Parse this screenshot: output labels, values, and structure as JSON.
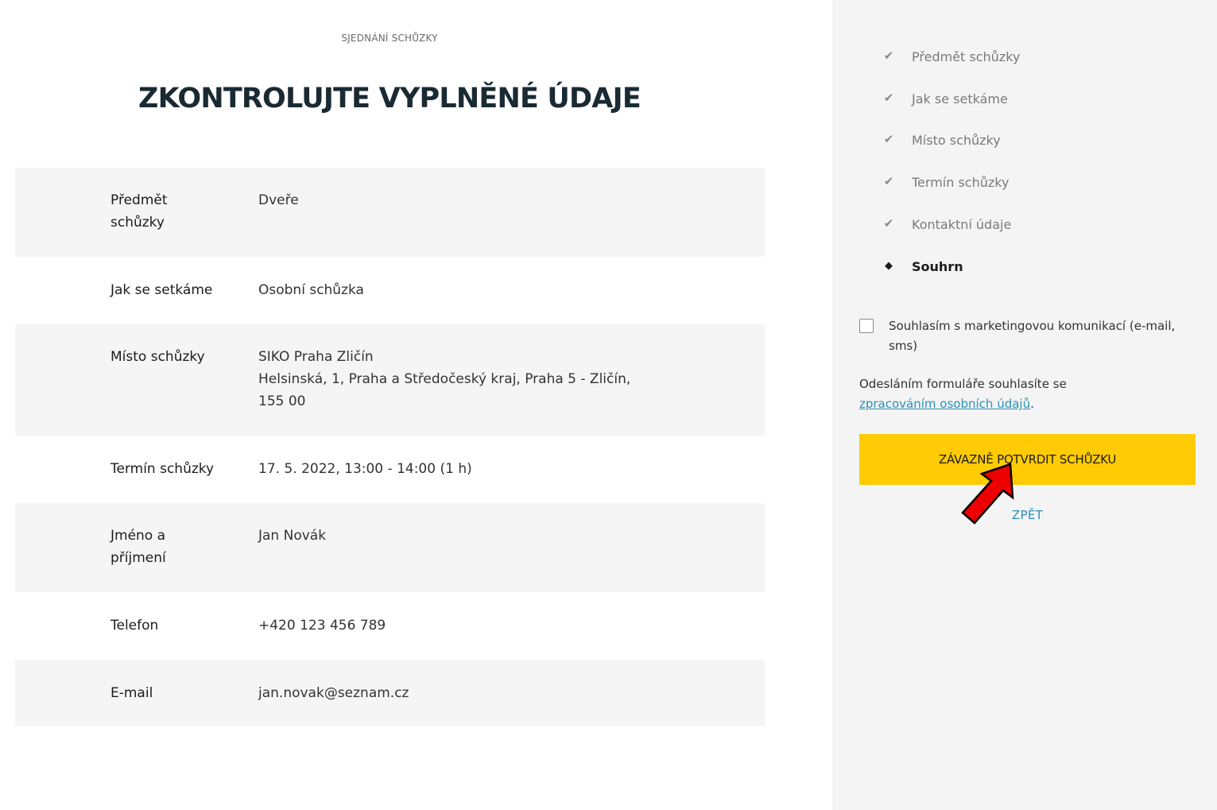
{
  "header": {
    "eyebrow": "SJEDNÁNÍ SCHŮZKY",
    "title": "ZKONTROLUJTE VYPLNĚNÉ ÚDAJE"
  },
  "summary": {
    "rows": [
      {
        "label": "Předmět\nschůzky",
        "value": "Dveře"
      },
      {
        "label": "Jak se setkáme",
        "value": "Osobní schůzka"
      },
      {
        "label": "Místo schůzky",
        "value": "SIKO Praha Zličín\nHelsinská, 1, Praha a Středočeský kraj, Praha 5 - Zličín,\n155 00"
      },
      {
        "label": "Termín schůzky",
        "value": "17. 5. 2022, 13:00 - 14:00 (1 h)"
      },
      {
        "label": "Jméno a\npříjmení",
        "value": "Jan Novák"
      },
      {
        "label": "Telefon",
        "value": "+420 123 456 789"
      },
      {
        "label": "E-mail",
        "value": "jan.novak@seznam.cz"
      }
    ]
  },
  "sidebar": {
    "steps": [
      {
        "label": "Předmět schůzky",
        "icon": "check-icon",
        "state": "done"
      },
      {
        "label": "Jak se setkáme",
        "icon": "check-icon",
        "state": "done"
      },
      {
        "label": "Místo schůzky",
        "icon": "check-icon",
        "state": "done"
      },
      {
        "label": "Termín schůzky",
        "icon": "check-icon",
        "state": "done"
      },
      {
        "label": "Kontaktní údaje",
        "icon": "check-icon",
        "state": "done"
      },
      {
        "label": "Souhrn",
        "icon": "diamond-bullet-icon",
        "state": "active"
      }
    ],
    "marketing_consent": {
      "label": "Souhlasím s marketingovou komunikací (e-mail, sms)",
      "checked": false
    },
    "note_prefix": "Odesláním formuláře souhlasíte se",
    "privacy_link": "zpracováním osobních údajů",
    "note_suffix": ".",
    "confirm_button": "ZÁVAZNĚ POTVRDIT SCHŮZKU",
    "back_link": "ZPĚT"
  },
  "colors": {
    "accent_yellow": "#ffcb05",
    "link_blue": "#2a8fb8",
    "title_dark": "#1a2a33",
    "annotation_arrow_red": "#ee0000",
    "row_shade": "#f5f5f5",
    "sidebar_bg": "#f4f4f4"
  }
}
